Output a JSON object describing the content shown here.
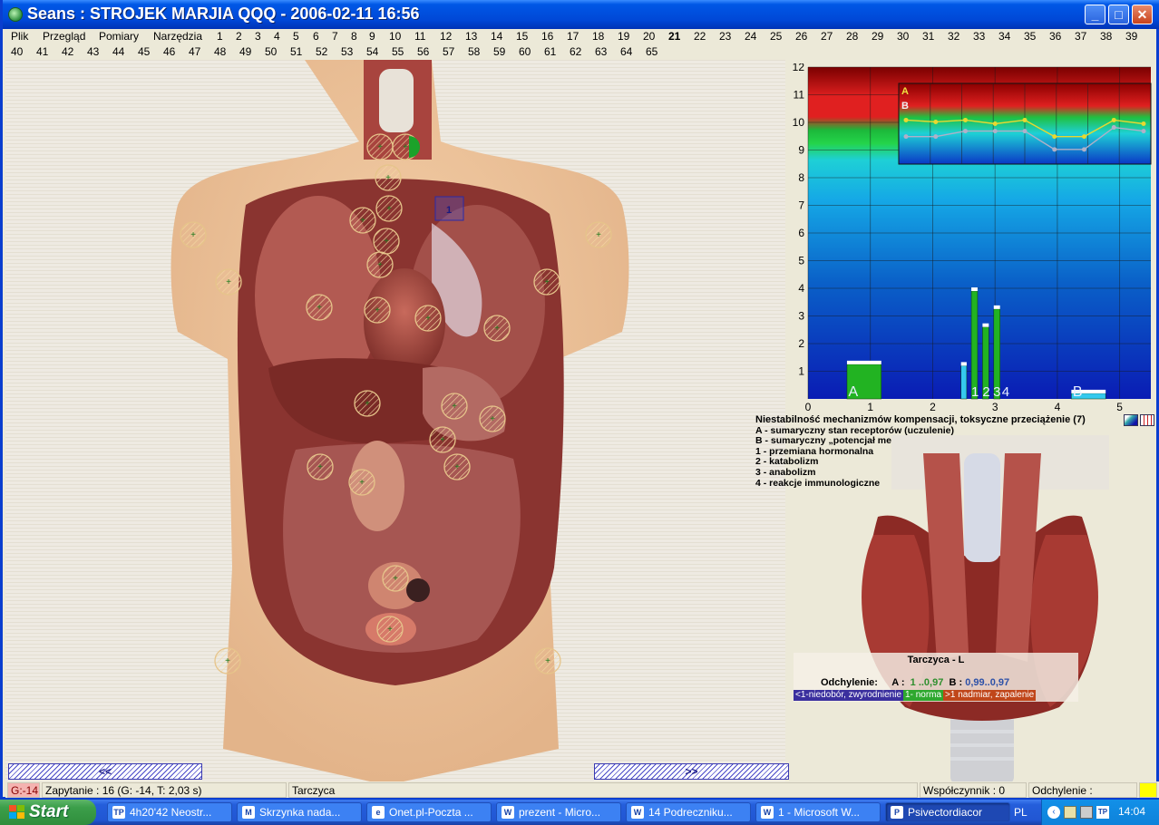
{
  "window": {
    "title": "Seans : STROJEK MARJIA QQQ - 2006-02-11 16:56"
  },
  "menu": {
    "items": [
      "Plik",
      "Przegląd",
      "Pomiary",
      "Narzędzia"
    ],
    "numbers_row1": [
      "1",
      "2",
      "3",
      "4",
      "5",
      "6",
      "7",
      "8",
      "9",
      "10",
      "11",
      "12",
      "13",
      "14",
      "15",
      "16",
      "17",
      "18",
      "19",
      "20",
      "21",
      "22",
      "23",
      "24",
      "25",
      "26",
      "27",
      "28",
      "29",
      "30",
      "31",
      "32",
      "33",
      "34",
      "35",
      "36",
      "37",
      "38",
      "39"
    ],
    "numbers_row2": [
      "40",
      "41",
      "42",
      "43",
      "44",
      "45",
      "46",
      "47",
      "48",
      "49",
      "50",
      "51",
      "52",
      "53",
      "54",
      "55",
      "56",
      "57",
      "58",
      "59",
      "60",
      "61",
      "62",
      "63",
      "64",
      "65"
    ],
    "selected_number": "21"
  },
  "colors": {
    "title_bar": "#0047d6",
    "bar_green": "#22b322",
    "bar_cyan": "#35c9ee",
    "line_a": "#e8d830",
    "line_b": "#b0b0c8",
    "marker": "#e6c48a"
  },
  "chart_data": {
    "type": "bar",
    "ylim": [
      0,
      12
    ],
    "xlim": [
      0,
      5.5
    ],
    "x_ticks": [
      "0",
      "1",
      "2",
      "3",
      "4",
      "5"
    ],
    "y_ticks": [
      "1",
      "2",
      "3",
      "4",
      "5",
      "6",
      "7",
      "8",
      "9",
      "10",
      "11",
      "12"
    ],
    "grid": true,
    "bars": [
      {
        "label": "A",
        "x": 0.9,
        "value": 1.25,
        "color": "green",
        "width": 0.55
      },
      {
        "label": "",
        "x": 2.5,
        "value": 1.2,
        "color": "cyan",
        "width": 0.09
      },
      {
        "label": "1",
        "x": 2.67,
        "value": 3.9,
        "color": "green",
        "width": 0.1
      },
      {
        "label": "2",
        "x": 2.85,
        "value": 2.6,
        "color": "green",
        "width": 0.1
      },
      {
        "label": "3",
        "x": 3.03,
        "value": 3.25,
        "color": "green",
        "width": 0.1
      },
      {
        "label": "4",
        "x": 3.0,
        "value": 0,
        "color": "green",
        "width": 0
      },
      {
        "label": "B",
        "x": 4.5,
        "value": 0.2,
        "color": "cyan",
        "width": 0.55
      }
    ],
    "inset": {
      "series": [
        {
          "name": "A",
          "values": [
            10.2,
            10.15,
            10.2,
            10.1,
            10.2,
            9.75,
            9.75,
            10.2,
            10.1
          ]
        },
        {
          "name": "B",
          "values": [
            9.75,
            9.75,
            9.9,
            9.9,
            9.9,
            9.4,
            9.4,
            10.0,
            9.9
          ]
        }
      ]
    }
  },
  "legend": {
    "title": "Niestabilność mechanizmów kompensacji, toksyczne przeciążenie (7)",
    "lines": [
      "A - sumaryczny stan receptorów (uczulenie)",
      "B - sumaryczny „potencjał membranowy” komórki (odczynowość)",
      "1 - przemiana hormonalna",
      "2 - katabolizm",
      "3 - anabolizm",
      "4 - reakcje immunologiczne"
    ]
  },
  "organ_info": {
    "name": "Tarczyca - L",
    "deviation_label": "Odchylenie:",
    "a_label": "A :",
    "a_value": "1 ..0,97",
    "b_label": "B :",
    "b_value": "0,99..0,97",
    "scale": [
      "<1-niedobór, zwyrodnienie",
      "1- norma",
      ">1 nadmiar, zapalenie"
    ]
  },
  "nav": {
    "prev": "<<",
    "next": ">>"
  },
  "status": {
    "badge": "G:-14",
    "query": "Zapytanie : 16 (G: -14, T: 2,03 s)",
    "organ": "Tarczyca",
    "coefficient": "Współczynnik : 0",
    "deviation": "Odchylenie :"
  },
  "taskbar": {
    "start": "Start",
    "tasks": [
      {
        "label": "4h20'42 Neostr...",
        "icon": "TP"
      },
      {
        "label": "Skrzynka nada...",
        "icon": "M"
      },
      {
        "label": "Onet.pl-Poczta ...",
        "icon": "e"
      },
      {
        "label": "prezent - Micro...",
        "icon": "W"
      },
      {
        "label": "14 Podreczniku...",
        "icon": "W"
      },
      {
        "label": "1 - Microsoft W...",
        "icon": "W"
      },
      {
        "label": "Psivectordiacor",
        "icon": "P"
      }
    ],
    "lang": "PL",
    "clock": "14:04"
  }
}
